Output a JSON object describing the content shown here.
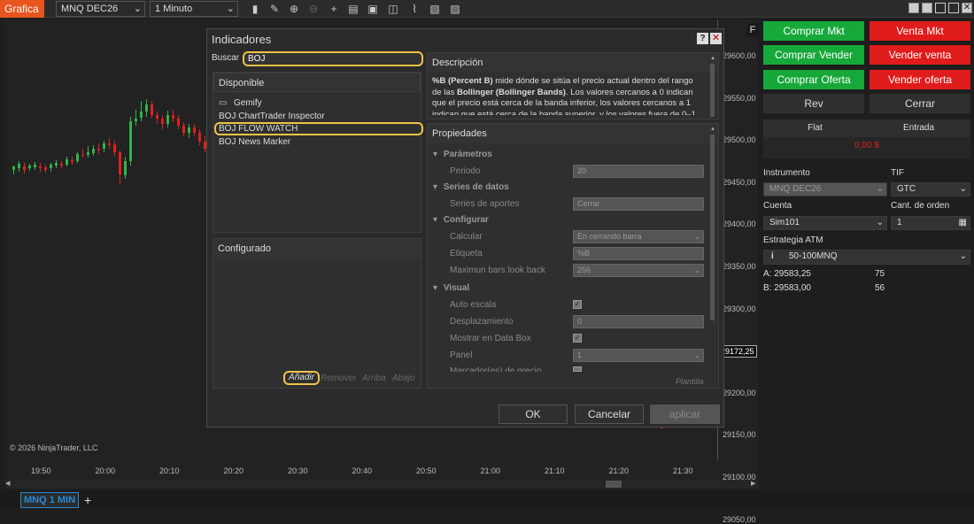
{
  "topbar": {
    "tab": "Grafica",
    "instrument": "MNQ DEC26",
    "interval": "1 Minuto"
  },
  "chart": {
    "copyright": "© 2026 NinjaTrader, LLC",
    "f_label": "F",
    "prices": [
      "29600,00",
      "29550,00",
      "29500,00",
      "29450,00",
      "29400,00",
      "29350,00",
      "29300,00",
      "29250,00",
      "29200,00",
      "29150,00",
      "29100,00",
      "29050,00"
    ],
    "current_price": "29172,25",
    "times": [
      "19:50",
      "20:00",
      "20:10",
      "20:20",
      "20:30",
      "20:40",
      "20:50",
      "21:00",
      "21:10",
      "21:20",
      "21:30"
    ],
    "up_color": "#2fb34a",
    "down_color": "#e02020"
  },
  "dialog": {
    "title": "Indicadores",
    "help": "?",
    "search_label": "Buscar",
    "search_value": "BOJ",
    "available_header": "Disponible",
    "folder": "Gemify",
    "items": [
      "BOJ ChartTrader Inspector",
      "BOJ FLOW WATCH",
      "BOJ News Marker"
    ],
    "configured_header": "Configurado",
    "add": "Añadir",
    "remove": "Remover",
    "up": "Arriba",
    "down": "Abajo",
    "description_header": "Descripción",
    "description_bold1": "%B (Percent B)",
    "description_t1": " mide dónde se sitúa el precio actual dentro del rango de las ",
    "description_bold2": "Bollinger (Bollinger Bands)",
    "description_t2": ". Los valores cercanos a 0 indican que el precio está cerca de la banda inferior, los valores cercanos a 1 indican que está cerca de la banda superior, y los valores fuera de 0–1",
    "properties_header": "Propiedades",
    "groups": {
      "params": "Parámetros",
      "series": "Series de datos",
      "config": "Configurar",
      "visual": "Visual"
    },
    "props": {
      "period_label": "Periodo",
      "period_value": "20",
      "input_label": "Series de aportes",
      "input_value": "Cerrar",
      "calc_label": "Calcular",
      "calc_value": "En cerrando barra",
      "tag_label": "Etiqueta",
      "tag_value": "%B",
      "lookback_label": "Maximun bars look back",
      "lookback_value": "256",
      "autoscale_label": "Auto escala",
      "displacement_label": "Desplazamiento",
      "displacement_value": "0",
      "databox_label": "Mostrar en Data Box",
      "panel_label": "Panel",
      "panel_value": "1",
      "markers_label": "Marcador(es) de precio"
    },
    "template": "Plantilla",
    "ok": "OK",
    "cancel": "Cancelar",
    "apply": "aplicar"
  },
  "trader": {
    "buy_mkt": "Comprar Mkt",
    "sell_mkt": "Venta Mkt",
    "buy_ask": "Comprar Vender",
    "sell_ask": "Vender venta",
    "buy_bid": "Comprar Oferta",
    "sell_bid": "Vender oferta",
    "rev": "Rev",
    "close": "Cerrar",
    "flat": "Flat",
    "entry": "Entrada",
    "pnl": "0,00 $",
    "instrument_label": "Instrumento",
    "instrument": "MNQ DEC26",
    "tif_label": "TIF",
    "tif": "GTC",
    "account_label": "Cuenta",
    "account": "Sim101",
    "qty_label": "Cant. de orden",
    "qty": "1",
    "atm_label": "Estrategia ATM",
    "atm": "50-100MNQ",
    "ask_prefix": "A:",
    "ask": "29583,25",
    "ask_size": "75",
    "bid_prefix": "B:",
    "bid": "29583,00",
    "bid_size": "56"
  },
  "bottom": {
    "tab": "MNQ 1 MIN",
    "add": "+"
  }
}
